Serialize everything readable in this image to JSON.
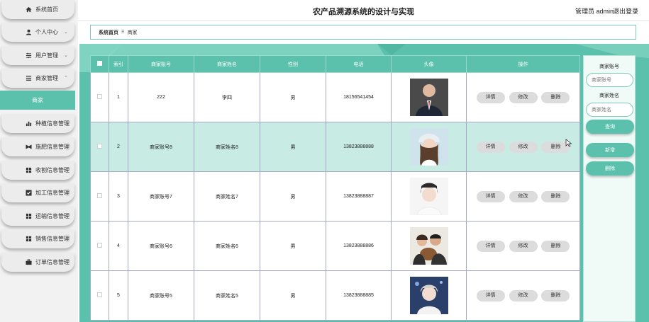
{
  "app": {
    "title": "农产品溯源系统的设计与实现",
    "user_label": "管理员 admin",
    "logout": "退出登录"
  },
  "sidebar": {
    "items": [
      {
        "label": "系统首页",
        "icon": "home-icon"
      },
      {
        "label": "个人中心",
        "icon": "person-icon"
      },
      {
        "label": "用户管理",
        "icon": "sliders-icon"
      },
      {
        "label": "商家管理",
        "icon": "list-icon"
      },
      {
        "label": "种植信息管理",
        "icon": "bar-chart-icon"
      },
      {
        "label": "施肥信息管理",
        "icon": "bowtie-icon"
      },
      {
        "label": "收割信息管理",
        "icon": "grid-icon"
      },
      {
        "label": "加工信息管理",
        "icon": "checkbox-icon"
      },
      {
        "label": "运输信息管理",
        "icon": "grid-icon"
      },
      {
        "label": "销售信息管理",
        "icon": "grid-icon"
      },
      {
        "label": "订单信息管理",
        "icon": "briefcase-icon"
      }
    ],
    "sub_item": "商家"
  },
  "breadcrumb": {
    "home": "系统首页",
    "sep": "Ξ",
    "current": "商家"
  },
  "table": {
    "headers": [
      "索引",
      "商家账号",
      "商家姓名",
      "性别",
      "电话",
      "头像",
      "操作"
    ],
    "rows": [
      {
        "index": "1",
        "account": "222",
        "name": "李四",
        "gender": "男",
        "phone": "18156541454"
      },
      {
        "index": "2",
        "account": "商家账号8",
        "name": "商家姓名8",
        "gender": "男",
        "phone": "13823888888"
      },
      {
        "index": "3",
        "account": "商家账号7",
        "name": "商家姓名7",
        "gender": "男",
        "phone": "13823888887"
      },
      {
        "index": "4",
        "account": "商家账号6",
        "name": "商家姓名6",
        "gender": "男",
        "phone": "13823888886"
      },
      {
        "index": "5",
        "account": "商家账号5",
        "name": "商家姓名5",
        "gender": "男",
        "phone": "13823888885"
      }
    ],
    "actions": {
      "detail": "详情",
      "edit": "修改",
      "delete": "删除"
    }
  },
  "search_panel": {
    "account_label": "商家账号",
    "account_placeholder": "商家账号",
    "name_label": "商家姓名",
    "name_placeholder": "商家姓名",
    "query": "查询",
    "add": "新增",
    "delete": "删除"
  },
  "colors": {
    "accent": "#5cc1ac",
    "highlight_row": "#c8ebe3"
  }
}
